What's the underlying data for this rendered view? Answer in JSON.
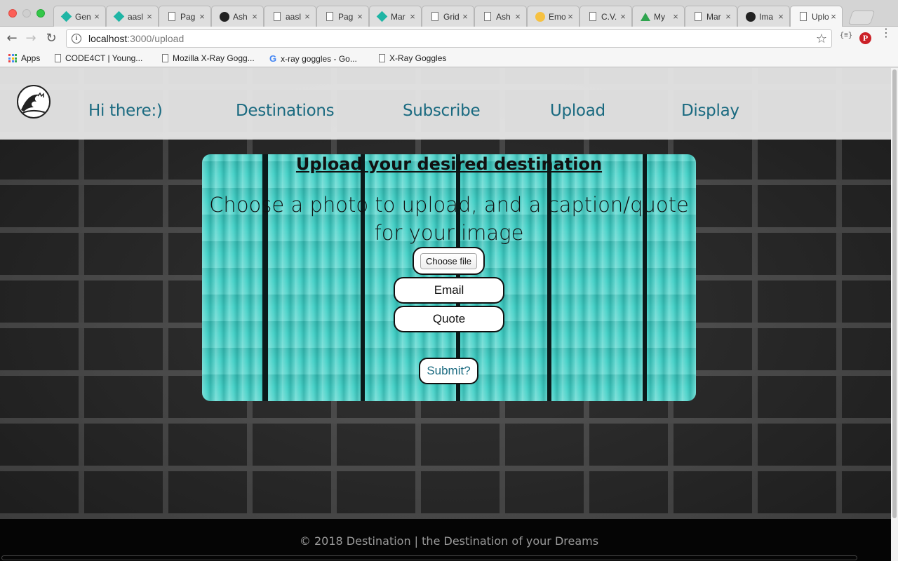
{
  "browser": {
    "tabs": [
      {
        "title": "Gen",
        "icon": "diamond-icon"
      },
      {
        "title": "aasl",
        "icon": "diamond-icon"
      },
      {
        "title": "Pag",
        "icon": "document-icon"
      },
      {
        "title": "Ash",
        "icon": "github-icon"
      },
      {
        "title": "aasl",
        "icon": "document-icon"
      },
      {
        "title": "Pag",
        "icon": "document-icon"
      },
      {
        "title": "Mar",
        "icon": "diamond-icon"
      },
      {
        "title": "Grid",
        "icon": "document-icon"
      },
      {
        "title": "Ash",
        "icon": "document-icon"
      },
      {
        "title": "Emo",
        "icon": "emoji-icon"
      },
      {
        "title": "C.V.",
        "icon": "document-icon"
      },
      {
        "title": "My",
        "icon": "drive-icon"
      },
      {
        "title": "Mar",
        "icon": "document-icon"
      },
      {
        "title": "Ima",
        "icon": "github-icon"
      },
      {
        "title": "Uplo",
        "icon": "document-icon",
        "active": true
      }
    ],
    "tab_close": "×",
    "url_host": "localhost",
    "url_path": ":3000/upload",
    "back": "←",
    "forward": "→",
    "reload": "↻",
    "info": "i",
    "star": "☆",
    "ext": "{≡}",
    "pinterest": "P",
    "menu": "⋮",
    "bookmarks": [
      {
        "label": "Apps",
        "icon": "apps-icon"
      },
      {
        "label": "CODE4CT | Young...",
        "icon": "document-icon"
      },
      {
        "label": "Mozilla X-Ray Gogg...",
        "icon": "document-icon"
      },
      {
        "label": "x-ray goggles - Go...",
        "icon": "google-icon"
      },
      {
        "label": "X-Ray Goggles",
        "icon": "document-icon"
      }
    ]
  },
  "site": {
    "nav": [
      "Hi there:)",
      "Destinations",
      "Subscribe",
      "Upload",
      "Display"
    ],
    "card": {
      "title": "Upload your desired destination",
      "subtitle": "Choose a photo to upload, and a caption/quote for your image",
      "file_button": "Choose file",
      "email_placeholder": "Email",
      "quote_placeholder": "Quote",
      "submit_label": "Submit?"
    },
    "footer": "© 2018 Destination | the Destination of your Dreams"
  },
  "colors": {
    "nav_link": "#1a6a80",
    "card_accent": "#3fd0c6",
    "footer_bg": "#050505"
  }
}
